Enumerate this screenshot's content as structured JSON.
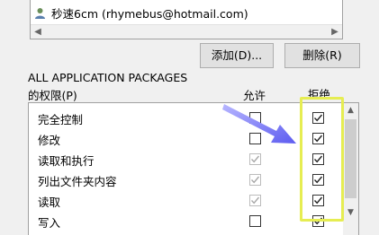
{
  "users_box": {
    "entries": [
      {
        "name": "秒速6cm (rhymebus@hotmail.com)"
      }
    ]
  },
  "buttons": {
    "add": "添加(D)...",
    "remove": "删除(R)"
  },
  "permissions": {
    "title_line1": "ALL APPLICATION PACKAGES",
    "title_line2": "的权限(P)",
    "col_allow": "允许",
    "col_deny": "拒绝",
    "rows": [
      {
        "name": "完全控制",
        "allow": false,
        "allow_disabled": false,
        "deny": true
      },
      {
        "name": "修改",
        "allow": false,
        "allow_disabled": false,
        "deny": true
      },
      {
        "name": "读取和执行",
        "allow": true,
        "allow_disabled": true,
        "deny": true
      },
      {
        "name": "列出文件夹内容",
        "allow": true,
        "allow_disabled": true,
        "deny": true
      },
      {
        "name": "读取",
        "allow": true,
        "allow_disabled": true,
        "deny": true
      },
      {
        "name": "写入",
        "allow": false,
        "allow_disabled": false,
        "deny": true
      }
    ]
  },
  "colors": {
    "highlight": "#e6ed52",
    "arrow": "#6f6ef0"
  }
}
